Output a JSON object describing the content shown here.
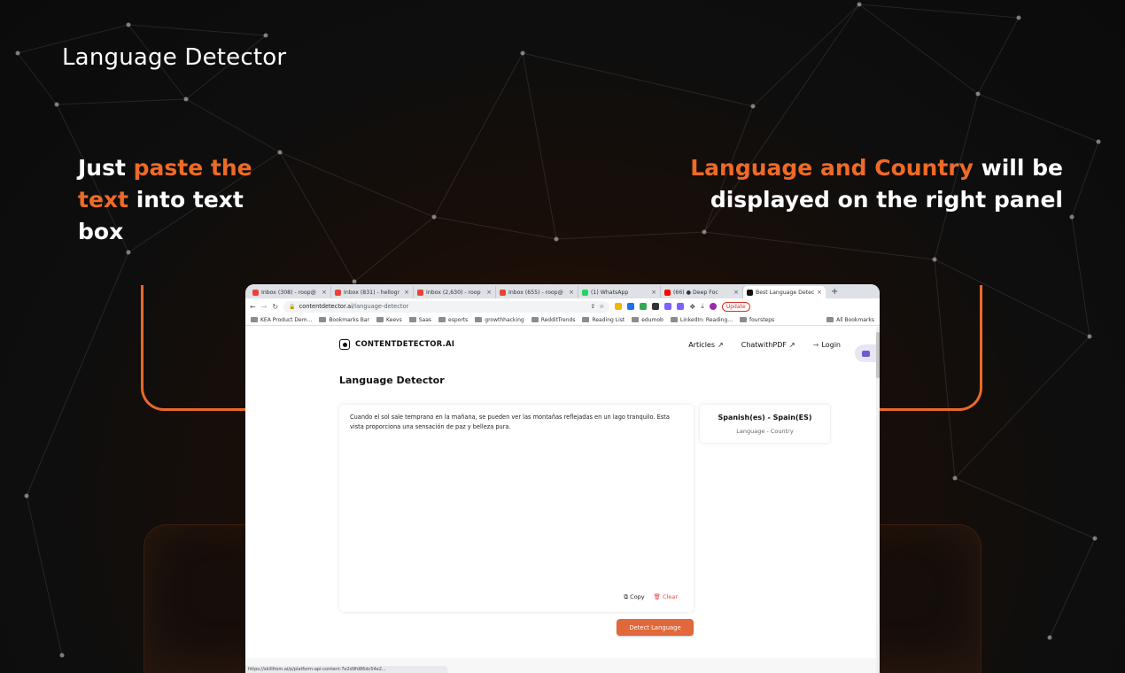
{
  "hero": {
    "title": "Language Detector",
    "left_caption": {
      "pre": "Just ",
      "highlight": "paste the text",
      "post": " into text box"
    },
    "right_caption": {
      "highlight": "Language and Country",
      "post": " will be displayed on the right panel"
    }
  },
  "colors": {
    "accent": "#ef6a26",
    "detect_button": "#e0683a",
    "background": "#0e0e0e"
  },
  "browser": {
    "tabs": [
      {
        "label": "Inbox (308) - roop@",
        "icon": "gmail-icon",
        "color": "#ea4335"
      },
      {
        "label": "Inbox (831) - hellogr",
        "icon": "gmail-icon",
        "color": "#ea4335"
      },
      {
        "label": "Inbox (2,630) - roop",
        "icon": "gmail-icon",
        "color": "#ea4335"
      },
      {
        "label": "Inbox (655) - roop@",
        "icon": "gmail-icon",
        "color": "#ea4335"
      },
      {
        "label": "(1) WhatsApp",
        "icon": "whatsapp-icon",
        "color": "#25d366"
      },
      {
        "label": "(66) ● Deep Foc",
        "icon": "youtube-icon",
        "color": "#ff0000"
      },
      {
        "label": "Best Language Detec",
        "icon": "contentdetector-icon",
        "color": "#111111"
      }
    ],
    "url": {
      "domain": "contentdetector.ai",
      "path": "/language-detector"
    },
    "update_label": "Update",
    "bookmarks": [
      "KEA Product Dem...",
      "Bookmarks Bar",
      "Keevs",
      "Saas",
      "esports",
      "growthhacking",
      "RedditTrends",
      "Reading List",
      "edumob",
      "LinkedIn: Reading...",
      "foursteps"
    ],
    "all_bookmarks": "All Bookmarks",
    "status_text": "https://skillfrom.ai/p/platform-api-content-7e2d9fd86dc54e2..."
  },
  "site": {
    "logo": "CONTENTDETECTOR.AI",
    "nav": {
      "articles": "Articles",
      "chatwithpdf": "ChatwithPDF",
      "login": "Login"
    },
    "heading": "Language Detector",
    "input_text": "Cuando el sol sale temprano en la mañana, se pueden ver las montañas reflejadas en un lago tranquilo. Esta vista proporciona una sensación de paz y belleza pura.",
    "copy_label": "Copy",
    "clear_label": "Clear",
    "result": {
      "language": "Spanish(es) - Spain(ES)",
      "sub": "Language - Country"
    },
    "detect_label": "Detect Language"
  }
}
